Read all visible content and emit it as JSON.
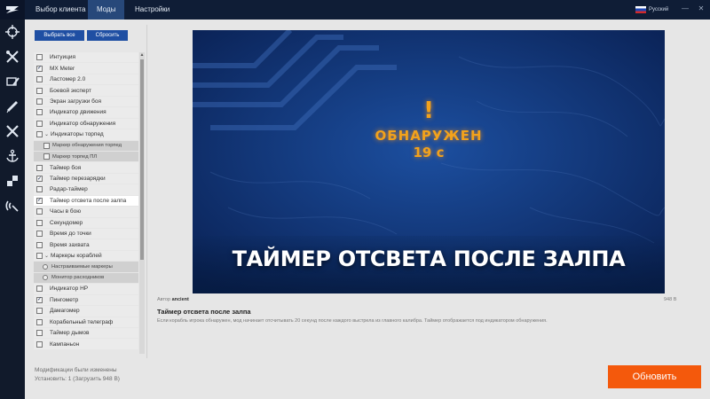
{
  "header": {
    "tabs": [
      {
        "label": "Выбор клиента"
      },
      {
        "label": "Моды"
      },
      {
        "label": "Настройки"
      }
    ],
    "language": "Русский",
    "minimize": "—",
    "close": "✕"
  },
  "rail": {
    "items": [
      "crosshair-icon",
      "tools-icon",
      "flag-edit-icon",
      "ship-panel-icon",
      "crossed-swords-icon",
      "anchor-icon",
      "transfer-icon",
      "radar-icon"
    ]
  },
  "actions": {
    "select_all": "Выбрать все",
    "reset": "Сбросить"
  },
  "mods": [
    {
      "label": "Интуиция",
      "type": "top",
      "checked": false
    },
    {
      "label": "MX Meter",
      "type": "top",
      "checked": true
    },
    {
      "label": "Ластомер 2.0",
      "type": "top",
      "checked": false
    },
    {
      "label": "Боевой эксперт",
      "type": "top",
      "checked": false
    },
    {
      "label": "Экран загрузки боя",
      "type": "top",
      "checked": false
    },
    {
      "label": "Индикатор движения",
      "type": "top",
      "checked": false
    },
    {
      "label": "Индикатор обнаружения",
      "type": "top",
      "checked": false
    },
    {
      "label": "Индикаторы торпед",
      "type": "group",
      "checked": false
    },
    {
      "label": "Маркер обнаружения торпед",
      "type": "sub",
      "checked": false
    },
    {
      "label": "Маркер торпед ПЛ",
      "type": "sub",
      "checked": false
    },
    {
      "label": "Таймер боя",
      "type": "top",
      "checked": false
    },
    {
      "label": "Таймер перезарядки",
      "type": "top",
      "checked": true
    },
    {
      "label": "Радар-таймер",
      "type": "top",
      "checked": false
    },
    {
      "label": "Таймер отсвета после залпа",
      "type": "top",
      "checked": true,
      "selected": true
    },
    {
      "label": "Часы в бою",
      "type": "top",
      "checked": false
    },
    {
      "label": "Секундомер",
      "type": "top",
      "checked": false
    },
    {
      "label": "Время до точки",
      "type": "top",
      "checked": false
    },
    {
      "label": "Время захвата",
      "type": "top",
      "checked": false
    },
    {
      "label": "Маркеры кораблей",
      "type": "group",
      "checked": false
    },
    {
      "label": "Настраиваемые маркеры",
      "type": "radio"
    },
    {
      "label": "Монитор расходников",
      "type": "radio"
    },
    {
      "label": "Индикатор HP",
      "type": "top",
      "checked": false
    },
    {
      "label": "Пингометр",
      "type": "top",
      "checked": true
    },
    {
      "label": "Дамагомер",
      "type": "top",
      "checked": false
    },
    {
      "label": "Корабельный телеграф",
      "type": "top",
      "checked": false
    },
    {
      "label": "Таймер дымов",
      "type": "top",
      "checked": false
    },
    {
      "label": "Кампаньон",
      "type": "top",
      "checked": false
    }
  ],
  "status": {
    "changed": "Модификации были изменены",
    "install": "Установить: 1 (Загрузить 948 В)"
  },
  "preview": {
    "exclamation": "!",
    "detected": "ОБНАРУЖЕН",
    "time": "19 с",
    "banner": "ТАЙМЕР ОТСВЕТА ПОСЛЕ ЗАЛПА"
  },
  "details": {
    "author_label": "Автор",
    "author": "ancient",
    "size": "948 В",
    "title": "Таймер отсвета после залпа",
    "description": "Если корабль игрока обнаружен, мод начинает отсчитывать 20 секунд после каждого выстрела из главного калибра. Таймер отображается под индикатором обнаружения."
  },
  "update_button": "Обновить",
  "colors": {
    "topbar": "#0f1d36",
    "active_tab": "#27487a",
    "accent_blue": "#1f4fa3",
    "update_orange": "#f4590c",
    "detect_orange": "#f2a21c"
  }
}
